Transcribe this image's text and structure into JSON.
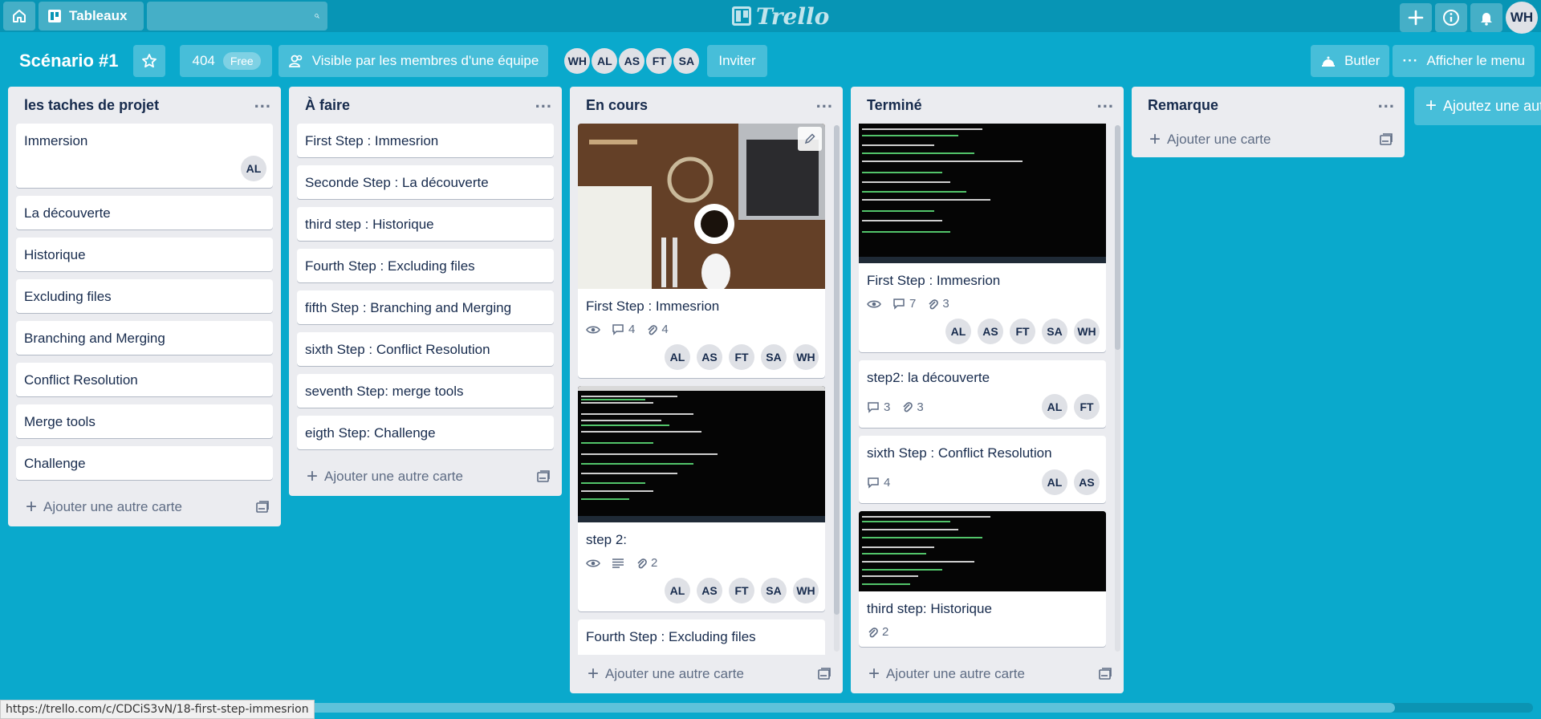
{
  "header": {
    "boards_label": "Tableaux",
    "search_value": "",
    "logo_text": "Trello",
    "user_initials": "WH"
  },
  "board": {
    "title": "Scénario #1",
    "count": "404",
    "plan": "Free",
    "visibility": "Visible par les membres d'une équipe",
    "members": [
      "WH",
      "AL",
      "AS",
      "FT",
      "SA"
    ],
    "invite": "Inviter",
    "butler": "Butler",
    "menu": "Afficher le menu"
  },
  "lists": {
    "l1": {
      "title": "les taches de projet",
      "card0": "Immersion",
      "card0_member": "AL",
      "cards": [
        "La découverte",
        "Historique",
        "Excluding files",
        "Branching and Merging",
        "Conflict Resolution",
        "Merge tools",
        "Challenge"
      ],
      "add": "Ajouter une autre carte"
    },
    "l2": {
      "title": "À faire",
      "cards": [
        "First Step : Immesrion",
        "Seconde Step : La découverte",
        "third step : Historique",
        "Fourth Step : Excluding files",
        "fifth Step : Branching and Merging",
        "sixth Step : Conflict Resolution",
        "seventh Step: merge tools",
        "eigth Step: Challenge"
      ],
      "add": "Ajouter une autre carte"
    },
    "l3": {
      "title": "En cours",
      "c1": {
        "title": "First Step : Immesrion",
        "comments": "4",
        "attachments": "4",
        "members": [
          "AL",
          "AS",
          "FT",
          "SA",
          "WH"
        ]
      },
      "c2": {
        "title": "step 2:",
        "attachments": "2",
        "members": [
          "AL",
          "AS",
          "FT",
          "SA",
          "WH"
        ]
      },
      "c3": {
        "title": "Fourth Step : Excluding files"
      },
      "add": "Ajouter une autre carte"
    },
    "l4": {
      "title": "Terminé",
      "c1": {
        "title": "First Step : Immesrion",
        "comments": "7",
        "attachments": "3",
        "members": [
          "AL",
          "AS",
          "FT",
          "SA",
          "WH"
        ]
      },
      "c2": {
        "title": "step2: la découverte",
        "comments": "3",
        "attachments": "3",
        "members": [
          "AL",
          "FT"
        ]
      },
      "c3": {
        "title": "sixth Step : Conflict Resolution",
        "comments": "4",
        "members": [
          "AL",
          "AS"
        ]
      },
      "c4": {
        "title": "third step: Historique",
        "attachments": "2"
      },
      "add": "Ajouter une autre carte"
    },
    "l5": {
      "title": "Remarque",
      "add": "Ajouter une carte"
    },
    "add_list": "Ajoutez une autre liste"
  },
  "status_url": "https://trello.com/c/CDCiS3vN/18-first-step-immesrion",
  "colors": {
    "background": "#0aa9cc",
    "header": "#0795b5",
    "list": "#ebecf0",
    "avatar": "#dfe1e6"
  }
}
